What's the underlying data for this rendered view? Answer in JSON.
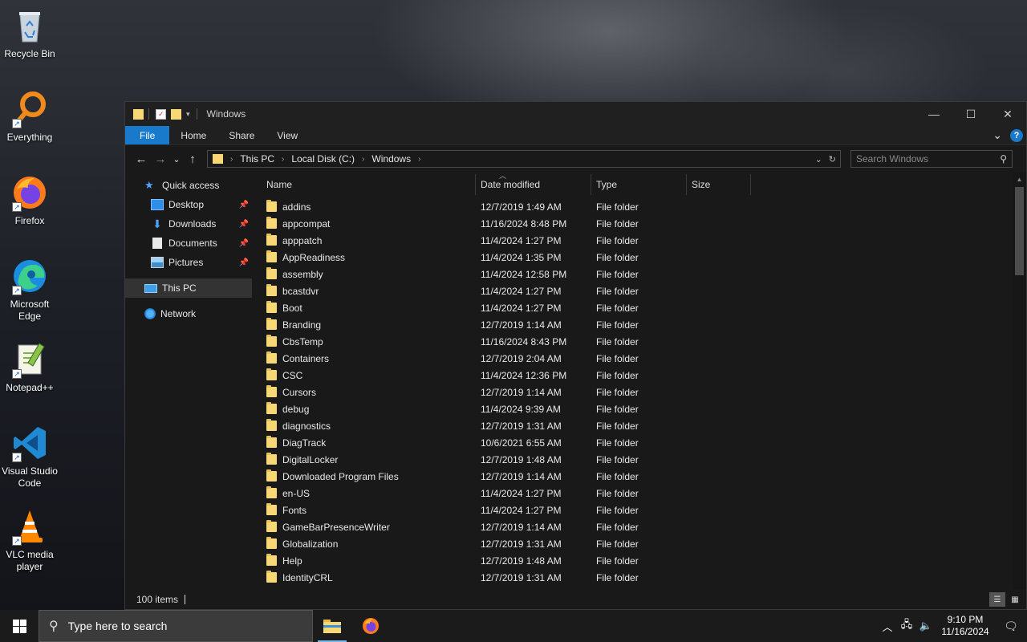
{
  "desktop": {
    "icons": [
      {
        "label": "Recycle Bin",
        "icon": "recycle-bin-icon"
      },
      {
        "label": "Everything",
        "icon": "everything-search-icon"
      },
      {
        "label": "Firefox",
        "icon": "firefox-icon"
      },
      {
        "label": "Microsoft Edge",
        "icon": "edge-icon"
      },
      {
        "label": "Notepad++",
        "icon": "notepad-plus-plus-icon"
      },
      {
        "label": "Visual Studio Code",
        "icon": "vscode-icon"
      },
      {
        "label": "VLC media player",
        "icon": "vlc-icon"
      }
    ]
  },
  "window": {
    "title": "Windows",
    "controls": {
      "minimize": "—",
      "maximize": "☐",
      "close": "✕"
    }
  },
  "ribbon": {
    "tabs": [
      "File",
      "Home",
      "Share",
      "View"
    ],
    "expand_glyph": "⌄",
    "help": "?"
  },
  "navigation": {
    "back": "←",
    "forward": "→",
    "recent": "⌄",
    "up": "↑",
    "breadcrumbs": [
      "This PC",
      "Local Disk (C:)",
      "Windows"
    ],
    "search_placeholder": "Search Windows"
  },
  "nav_pane": {
    "quick_access": "Quick access",
    "pinned": [
      "Desktop",
      "Downloads",
      "Documents",
      "Pictures"
    ],
    "this_pc": "This PC",
    "network": "Network"
  },
  "columns": [
    "Name",
    "Date modified",
    "Type",
    "Size"
  ],
  "files": [
    {
      "name": "addins",
      "date": "12/7/2019 1:49 AM",
      "type": "File folder"
    },
    {
      "name": "appcompat",
      "date": "11/16/2024 8:48 PM",
      "type": "File folder"
    },
    {
      "name": "apppatch",
      "date": "11/4/2024 1:27 PM",
      "type": "File folder"
    },
    {
      "name": "AppReadiness",
      "date": "11/4/2024 1:35 PM",
      "type": "File folder"
    },
    {
      "name": "assembly",
      "date": "11/4/2024 12:58 PM",
      "type": "File folder"
    },
    {
      "name": "bcastdvr",
      "date": "11/4/2024 1:27 PM",
      "type": "File folder"
    },
    {
      "name": "Boot",
      "date": "11/4/2024 1:27 PM",
      "type": "File folder"
    },
    {
      "name": "Branding",
      "date": "12/7/2019 1:14 AM",
      "type": "File folder"
    },
    {
      "name": "CbsTemp",
      "date": "11/16/2024 8:43 PM",
      "type": "File folder"
    },
    {
      "name": "Containers",
      "date": "12/7/2019 2:04 AM",
      "type": "File folder"
    },
    {
      "name": "CSC",
      "date": "11/4/2024 12:36 PM",
      "type": "File folder"
    },
    {
      "name": "Cursors",
      "date": "12/7/2019 1:14 AM",
      "type": "File folder"
    },
    {
      "name": "debug",
      "date": "11/4/2024 9:39 AM",
      "type": "File folder"
    },
    {
      "name": "diagnostics",
      "date": "12/7/2019 1:31 AM",
      "type": "File folder"
    },
    {
      "name": "DiagTrack",
      "date": "10/6/2021 6:55 AM",
      "type": "File folder"
    },
    {
      "name": "DigitalLocker",
      "date": "12/7/2019 1:48 AM",
      "type": "File folder"
    },
    {
      "name": "Downloaded Program Files",
      "date": "12/7/2019 1:14 AM",
      "type": "File folder"
    },
    {
      "name": "en-US",
      "date": "11/4/2024 1:27 PM",
      "type": "File folder"
    },
    {
      "name": "Fonts",
      "date": "11/4/2024 1:27 PM",
      "type": "File folder"
    },
    {
      "name": "GameBarPresenceWriter",
      "date": "12/7/2019 1:14 AM",
      "type": "File folder"
    },
    {
      "name": "Globalization",
      "date": "12/7/2019 1:31 AM",
      "type": "File folder"
    },
    {
      "name": "Help",
      "date": "12/7/2019 1:48 AM",
      "type": "File folder"
    },
    {
      "name": "IdentityCRL",
      "date": "12/7/2019 1:31 AM",
      "type": "File folder"
    }
  ],
  "status": {
    "item_count": "100 items"
  },
  "taskbar": {
    "search_placeholder": "Type here to search",
    "time": "9:10 PM",
    "date": "11/16/2024"
  },
  "colors": {
    "accent": "#1979ca",
    "folder": "#f8d775",
    "window_bg": "#191919"
  }
}
